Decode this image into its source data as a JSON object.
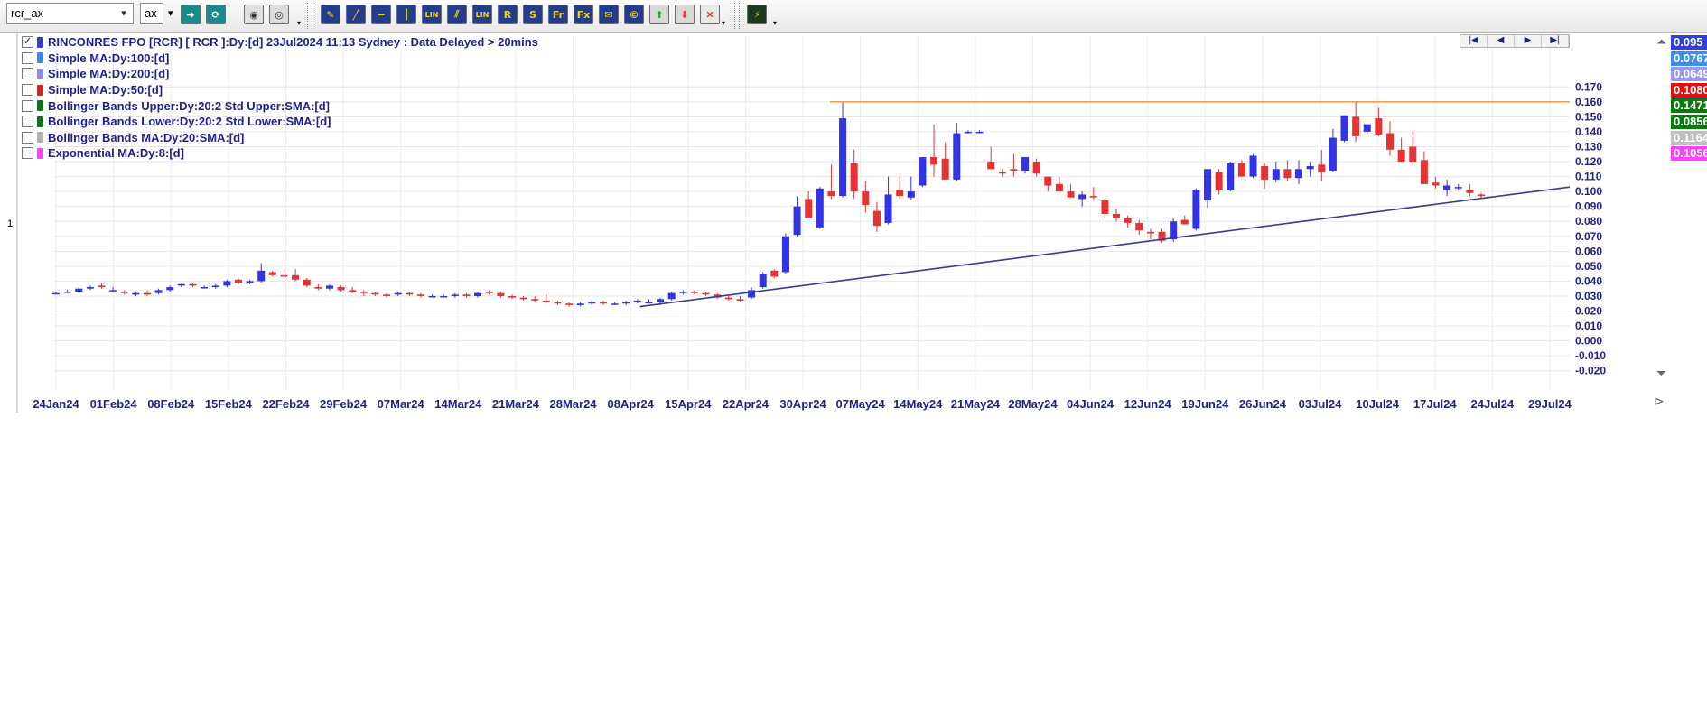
{
  "toolbar": {
    "symbol_value": "rcr_ax",
    "suffix_value": "ax",
    "buttons": [
      {
        "icon": "go-arrow-icon",
        "glyph": "➜",
        "bg": "#1a8a8a"
      },
      {
        "icon": "refresh-icon",
        "glyph": "⟳",
        "bg": "#1a8a8a"
      },
      {
        "icon": "binoculars-icon",
        "glyph": "◉",
        "bg": "#e0e0e0"
      },
      {
        "icon": "binoculars-grey-icon",
        "glyph": "◎",
        "bg": "#dcdcdc"
      },
      {
        "icon": "draw-line-icon",
        "glyph": "✎",
        "bg": "#243c8c"
      },
      {
        "icon": "trend-line-icon",
        "glyph": "╱",
        "bg": "#243c8c"
      },
      {
        "icon": "horizontal-line-icon",
        "glyph": "━",
        "bg": "#243c8c"
      },
      {
        "icon": "vertical-line-icon",
        "glyph": "┃",
        "bg": "#243c8c"
      },
      {
        "icon": "lin-regression-icon",
        "glyph": "LIN",
        "bg": "#243c8c"
      },
      {
        "icon": "parallel-lines-icon",
        "glyph": "⫽",
        "bg": "#243c8c"
      },
      {
        "icon": "lin-channel-icon",
        "glyph": "LIN",
        "bg": "#243c8c"
      },
      {
        "icon": "resistance-icon",
        "glyph": "R",
        "bg": "#243c8c"
      },
      {
        "icon": "support-icon",
        "glyph": "S",
        "bg": "#243c8c"
      },
      {
        "icon": "fib-retracement-icon",
        "glyph": "Fr",
        "bg": "#243c8c"
      },
      {
        "icon": "fib-extension-icon",
        "glyph": "Fx",
        "bg": "#243c8c"
      },
      {
        "icon": "text-note-icon",
        "glyph": "✉",
        "bg": "#243c8c"
      },
      {
        "icon": "annotation-icon",
        "glyph": "©",
        "bg": "#243c8c"
      },
      {
        "icon": "buy-arrow-icon",
        "glyph": "⬆",
        "bg": "#d8d8d8"
      },
      {
        "icon": "sell-arrow-icon",
        "glyph": "⬇",
        "bg": "#d8d8d8"
      },
      {
        "icon": "delete-icon",
        "glyph": "✕",
        "bg": "#e8e8e8"
      },
      {
        "icon": "lightning-icon",
        "glyph": "⚡",
        "bg": "#1e3a1e"
      }
    ]
  },
  "legend": [
    {
      "checked": true,
      "color": "#3a3ad6",
      "label": "RINCONRES FPO [RCR] [ RCR ]:Dy:[d]  23Jul2024 11:13 Sydney : Data Delayed > 20mins"
    },
    {
      "checked": false,
      "color": "#2c8df0",
      "label": "Simple MA:Dy:100:[d]"
    },
    {
      "checked": false,
      "color": "#8e8ee8",
      "label": "Simple MA:Dy:200:[d]"
    },
    {
      "checked": false,
      "color": "#e02020",
      "label": "Simple MA:Dy:50:[d]"
    },
    {
      "checked": false,
      "color": "#0a7a0a",
      "label": "Bollinger Bands Upper:Dy:20:2 Std Upper:SMA:[d]"
    },
    {
      "checked": false,
      "color": "#0a7a0a",
      "label": "Bollinger Bands Lower:Dy:20:2 Std Lower:SMA:[d]"
    },
    {
      "checked": false,
      "color": "#b0b0b0",
      "label": "Bollinger Bands MA:Dy:20:SMA:[d]"
    },
    {
      "checked": false,
      "color": "#ff40ff",
      "label": "Exponential MA:Dy:8:[d]"
    }
  ],
  "value_boxes": [
    {
      "text": "0.095",
      "bg": "#2f3fe0"
    },
    {
      "text": "0.0767",
      "bg": "#3a8ff0"
    },
    {
      "text": "0.0649",
      "bg": "#9a9ae8"
    },
    {
      "text": "0.1080",
      "bg": "#e01010"
    },
    {
      "text": "0.1471",
      "bg": "#0a7a0a"
    },
    {
      "text": "0.0856",
      "bg": "#0a7a0a"
    },
    {
      "text": "0.1164",
      "bg": "#c0c0c0"
    },
    {
      "text": "0.1056",
      "bg": "#ff40ff"
    }
  ],
  "panel_label": "1",
  "nav": [
    "|◀",
    "◀",
    "▶",
    "▶|"
  ],
  "colors": {
    "up": "#3232e6",
    "down": "#e63232",
    "resistance": "#f0a050",
    "trendline": "#3a3a90",
    "axis_text": "#1f1f8f"
  },
  "chart_data": {
    "type": "candlestick",
    "ylim": [
      -0.025,
      0.175
    ],
    "yticks": [
      "0.170",
      "0.160",
      "0.150",
      "0.140",
      "0.130",
      "0.120",
      "0.110",
      "0.100",
      "0.090",
      "0.080",
      "0.070",
      "0.060",
      "0.050",
      "0.040",
      "0.030",
      "0.020",
      "0.010",
      "0.000",
      "-0.010",
      "-0.020"
    ],
    "xtick_labels": [
      "24Jan24",
      "01Feb24",
      "08Feb24",
      "15Feb24",
      "22Feb24",
      "29Feb24",
      "07Mar24",
      "14Mar24",
      "21Mar24",
      "28Mar24",
      "08Apr24",
      "15Apr24",
      "22Apr24",
      "30Apr24",
      "07May24",
      "14May24",
      "21May24",
      "28May24",
      "04Jun24",
      "12Jun24",
      "19Jun24",
      "26Jun24",
      "03Jul24",
      "10Jul24",
      "17Jul24",
      "24Jul24",
      "29Jul24"
    ],
    "candles": [
      [
        0.032,
        0.033,
        0.031,
        0.032
      ],
      [
        0.033,
        0.034,
        0.032,
        0.033
      ],
      [
        0.033,
        0.036,
        0.033,
        0.035
      ],
      [
        0.035,
        0.037,
        0.034,
        0.036
      ],
      [
        0.037,
        0.039,
        0.035,
        0.036
      ],
      [
        0.034,
        0.036,
        0.033,
        0.034
      ],
      [
        0.033,
        0.034,
        0.031,
        0.032
      ],
      [
        0.031,
        0.033,
        0.03,
        0.032
      ],
      [
        0.032,
        0.034,
        0.03,
        0.031
      ],
      [
        0.032,
        0.035,
        0.031,
        0.034
      ],
      [
        0.034,
        0.037,
        0.033,
        0.036
      ],
      [
        0.037,
        0.039,
        0.036,
        0.038
      ],
      [
        0.038,
        0.039,
        0.036,
        0.037
      ],
      [
        0.036,
        0.037,
        0.035,
        0.036
      ],
      [
        0.036,
        0.038,
        0.035,
        0.037
      ],
      [
        0.037,
        0.041,
        0.036,
        0.04
      ],
      [
        0.041,
        0.042,
        0.038,
        0.039
      ],
      [
        0.039,
        0.041,
        0.038,
        0.04
      ],
      [
        0.04,
        0.052,
        0.039,
        0.047
      ],
      [
        0.046,
        0.047,
        0.043,
        0.044
      ],
      [
        0.044,
        0.046,
        0.042,
        0.043
      ],
      [
        0.044,
        0.048,
        0.04,
        0.041
      ],
      [
        0.041,
        0.042,
        0.036,
        0.037
      ],
      [
        0.036,
        0.038,
        0.034,
        0.035
      ],
      [
        0.035,
        0.038,
        0.034,
        0.037
      ],
      [
        0.036,
        0.037,
        0.033,
        0.034
      ],
      [
        0.034,
        0.036,
        0.032,
        0.033
      ],
      [
        0.033,
        0.034,
        0.03,
        0.032
      ],
      [
        0.032,
        0.033,
        0.03,
        0.031
      ],
      [
        0.031,
        0.032,
        0.029,
        0.03
      ],
      [
        0.031,
        0.033,
        0.03,
        0.032
      ],
      [
        0.032,
        0.033,
        0.03,
        0.031
      ],
      [
        0.031,
        0.032,
        0.029,
        0.03
      ],
      [
        0.03,
        0.031,
        0.029,
        0.03
      ],
      [
        0.03,
        0.031,
        0.029,
        0.03
      ],
      [
        0.03,
        0.032,
        0.029,
        0.031
      ],
      [
        0.031,
        0.032,
        0.029,
        0.03
      ],
      [
        0.03,
        0.033,
        0.029,
        0.032
      ],
      [
        0.033,
        0.034,
        0.031,
        0.032
      ],
      [
        0.032,
        0.033,
        0.029,
        0.03
      ],
      [
        0.03,
        0.031,
        0.028,
        0.029
      ],
      [
        0.029,
        0.03,
        0.027,
        0.028
      ],
      [
        0.028,
        0.03,
        0.026,
        0.027
      ],
      [
        0.027,
        0.031,
        0.025,
        0.026
      ],
      [
        0.026,
        0.027,
        0.024,
        0.025
      ],
      [
        0.025,
        0.026,
        0.023,
        0.024
      ],
      [
        0.024,
        0.026,
        0.023,
        0.025
      ],
      [
        0.025,
        0.027,
        0.024,
        0.026
      ],
      [
        0.026,
        0.027,
        0.024,
        0.025
      ],
      [
        0.025,
        0.026,
        0.024,
        0.025
      ],
      [
        0.025,
        0.027,
        0.024,
        0.026
      ],
      [
        0.026,
        0.028,
        0.025,
        0.027
      ],
      [
        0.026,
        0.028,
        0.025,
        0.026
      ],
      [
        0.026,
        0.029,
        0.024,
        0.028
      ],
      [
        0.028,
        0.033,
        0.027,
        0.032
      ],
      [
        0.032,
        0.034,
        0.031,
        0.033
      ],
      [
        0.033,
        0.034,
        0.031,
        0.032
      ],
      [
        0.032,
        0.033,
        0.03,
        0.031
      ],
      [
        0.031,
        0.032,
        0.028,
        0.029
      ],
      [
        0.029,
        0.03,
        0.027,
        0.028
      ],
      [
        0.028,
        0.03,
        0.026,
        0.027
      ],
      [
        0.029,
        0.036,
        0.028,
        0.034
      ],
      [
        0.036,
        0.046,
        0.035,
        0.045
      ],
      [
        0.047,
        0.048,
        0.042,
        0.043
      ],
      [
        0.046,
        0.072,
        0.045,
        0.07
      ],
      [
        0.071,
        0.097,
        0.07,
        0.09
      ],
      [
        0.095,
        0.1,
        0.082,
        0.082
      ],
      [
        0.076,
        0.103,
        0.075,
        0.102
      ],
      [
        0.1,
        0.118,
        0.095,
        0.097
      ],
      [
        0.097,
        0.16,
        0.096,
        0.149
      ],
      [
        0.119,
        0.128,
        0.095,
        0.1
      ],
      [
        0.1,
        0.107,
        0.086,
        0.091
      ],
      [
        0.087,
        0.093,
        0.073,
        0.077
      ],
      [
        0.079,
        0.11,
        0.078,
        0.098
      ],
      [
        0.101,
        0.11,
        0.095,
        0.097
      ],
      [
        0.096,
        0.11,
        0.094,
        0.1
      ],
      [
        0.104,
        0.123,
        0.103,
        0.123
      ],
      [
        0.123,
        0.145,
        0.11,
        0.118
      ],
      [
        0.122,
        0.133,
        0.108,
        0.108
      ],
      [
        0.108,
        0.146,
        0.107,
        0.139
      ],
      [
        0.14,
        0.141,
        0.139,
        0.14
      ],
      [
        0.14,
        0.141,
        0.139,
        0.14
      ],
      [
        0.12,
        0.13,
        0.115,
        0.115
      ],
      [
        0.113,
        0.115,
        0.11,
        0.112
      ],
      [
        0.115,
        0.125,
        0.11,
        0.114
      ],
      [
        0.114,
        0.123,
        0.112,
        0.123
      ],
      [
        0.12,
        0.122,
        0.11,
        0.112
      ],
      [
        0.11,
        0.11,
        0.1,
        0.104
      ],
      [
        0.105,
        0.11,
        0.1,
        0.1
      ],
      [
        0.1,
        0.105,
        0.098,
        0.096
      ],
      [
        0.095,
        0.1,
        0.09,
        0.098
      ],
      [
        0.097,
        0.103,
        0.095,
        0.096
      ],
      [
        0.094,
        0.095,
        0.082,
        0.085
      ],
      [
        0.085,
        0.088,
        0.08,
        0.082
      ],
      [
        0.082,
        0.084,
        0.076,
        0.079
      ],
      [
        0.079,
        0.081,
        0.071,
        0.074
      ],
      [
        0.073,
        0.075,
        0.068,
        0.072
      ],
      [
        0.073,
        0.075,
        0.066,
        0.067
      ],
      [
        0.068,
        0.082,
        0.066,
        0.08
      ],
      [
        0.081,
        0.084,
        0.078,
        0.078
      ],
      [
        0.075,
        0.102,
        0.074,
        0.101
      ],
      [
        0.094,
        0.115,
        0.089,
        0.115
      ],
      [
        0.113,
        0.115,
        0.098,
        0.101
      ],
      [
        0.101,
        0.12,
        0.1,
        0.119
      ],
      [
        0.119,
        0.121,
        0.11,
        0.11
      ],
      [
        0.11,
        0.125,
        0.109,
        0.124
      ],
      [
        0.117,
        0.119,
        0.102,
        0.108
      ],
      [
        0.108,
        0.12,
        0.106,
        0.115
      ],
      [
        0.115,
        0.121,
        0.107,
        0.109
      ],
      [
        0.109,
        0.121,
        0.105,
        0.115
      ],
      [
        0.115,
        0.12,
        0.11,
        0.117
      ],
      [
        0.118,
        0.128,
        0.107,
        0.113
      ],
      [
        0.114,
        0.142,
        0.113,
        0.136
      ],
      [
        0.134,
        0.151,
        0.133,
        0.151
      ],
      [
        0.15,
        0.16,
        0.133,
        0.137
      ],
      [
        0.14,
        0.145,
        0.138,
        0.145
      ],
      [
        0.149,
        0.156,
        0.137,
        0.138
      ],
      [
        0.139,
        0.147,
        0.124,
        0.128
      ],
      [
        0.128,
        0.136,
        0.12,
        0.12
      ],
      [
        0.13,
        0.14,
        0.118,
        0.12
      ],
      [
        0.121,
        0.127,
        0.106,
        0.105
      ],
      [
        0.106,
        0.11,
        0.102,
        0.104
      ],
      [
        0.101,
        0.108,
        0.097,
        0.104
      ],
      [
        0.103,
        0.105,
        0.101,
        0.103
      ],
      [
        0.101,
        0.105,
        0.097,
        0.099
      ],
      [
        0.098,
        0.099,
        0.095,
        0.097
      ]
    ],
    "resistance_value": 0.16,
    "trendline": {
      "from_candle": 49,
      "from_value": 0.023,
      "to_value": 0.103
    }
  }
}
